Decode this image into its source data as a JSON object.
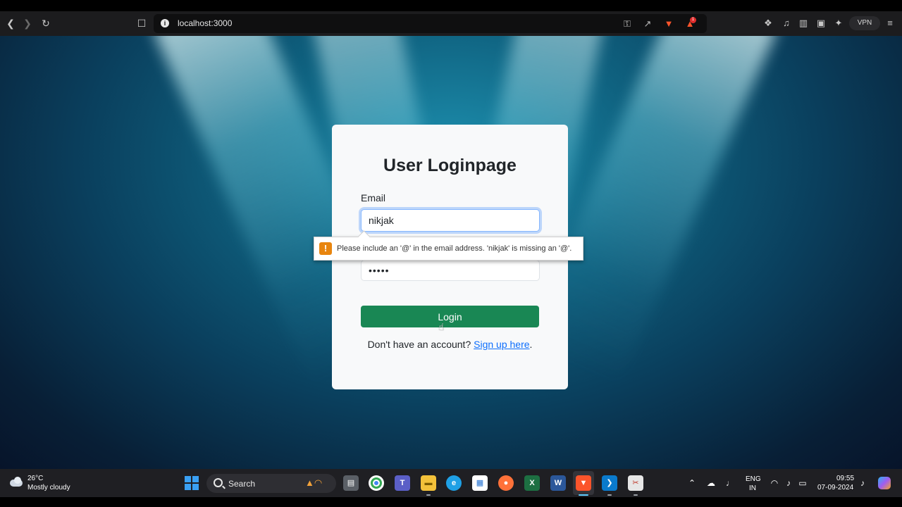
{
  "browser": {
    "url": "localhost:3000",
    "rewards_count": "1",
    "vpn_label": "VPN",
    "icons": {
      "back": "back-arrow-icon",
      "forward": "forward-arrow-icon",
      "reload": "reload-icon",
      "bookmark": "bookmark-icon",
      "site_info": "info-icon",
      "password_key": "key-icon",
      "share": "share-icon",
      "brave_shields": "brave-lion-icon",
      "rewards": "brave-rewards-icon",
      "extensions": "puzzle-icon",
      "media": "music-note-icon",
      "sidebar": "sidebar-icon",
      "wallet": "wallet-icon",
      "leo": "leo-ai-icon",
      "menu": "hamburger-menu-icon"
    }
  },
  "login": {
    "title": "User Loginpage",
    "email_label": "Email",
    "email_value": "nikjak",
    "password_value": "•••••",
    "button_label": "Login",
    "signup_prefix": "Don't have an account? ",
    "signup_link": "Sign up here",
    "signup_suffix": ".",
    "validation_message": "Please include an '@' in the email address. 'nikjak' is missing an '@'."
  },
  "taskbar": {
    "weather_temp": "26°C",
    "weather_desc": "Mostly cloudy",
    "search_label": "Search",
    "lang_top": "ENG",
    "lang_bottom": "IN",
    "time": "09:55",
    "date": "07-09-2024",
    "apps": [
      "task-view",
      "chrome",
      "teams",
      "file-explorer",
      "edge",
      "microsoft-store",
      "firefox",
      "excel",
      "word",
      "brave",
      "vscode",
      "snipping-tool"
    ]
  },
  "colors": {
    "login_button": "#198754",
    "link": "#0d6efd",
    "focus_border": "#86b7fe",
    "warning": "#e8850f"
  }
}
